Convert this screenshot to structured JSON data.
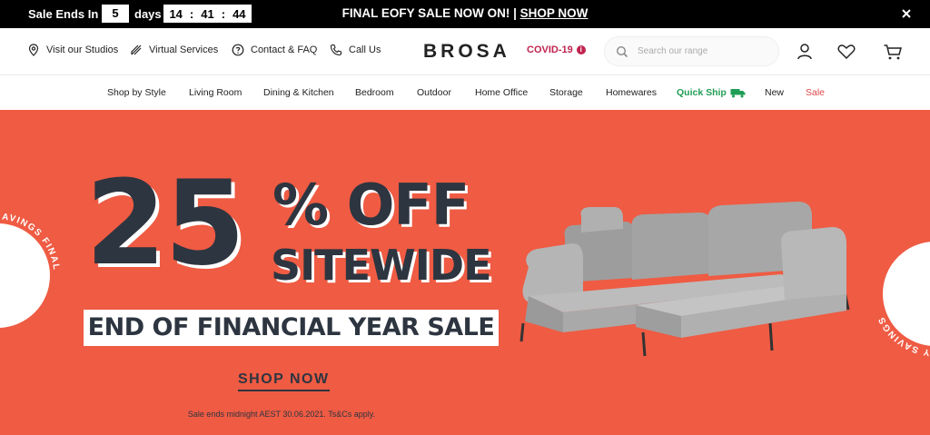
{
  "topbar": {
    "sale_ends_label": "Sale Ends In",
    "days_value": "5",
    "days_label": "days",
    "hours": "14",
    "minutes": "41",
    "seconds": "44",
    "promo_text": "FINAL EOFY SALE NOW ON! |",
    "promo_link": "SHOP NOW"
  },
  "header": {
    "visit_studios": "Visit our Studios",
    "virtual_services": "Virtual Services",
    "contact_faq": "Contact & FAQ",
    "call_us": "Call Us",
    "logo": "BROSA",
    "covid": "COVID-19",
    "covid_dot": "i",
    "search_placeholder": "Search our range"
  },
  "nav": {
    "items": [
      "Shop by Style",
      "Living Room",
      "Dining & Kitchen",
      "Bedroom",
      "Outdoor",
      "Home Office",
      "Storage",
      "Homewares",
      "Quick Ship",
      "New",
      "Sale"
    ]
  },
  "hero": {
    "big_number": "25",
    "percent_off": "% OFF",
    "sitewide": "SITEWIDE",
    "eofy": "END OF FINANCIAL YEAR SALE",
    "cta": "SHOP NOW",
    "terms": "Sale ends midnight AEST 30.06.2021. Ts&Cs apply.",
    "badge_left_text": "CHANCE EOFY SAVINGS FINAL",
    "badge_right_text": "FINAL CHANCE EOFY SAVINGS"
  },
  "colors": {
    "hero_bg": "#ef5b43",
    "navy": "#2d3540",
    "covid": "#c0234f",
    "quick_ship": "#1f9e55",
    "sale": "#e04848"
  }
}
